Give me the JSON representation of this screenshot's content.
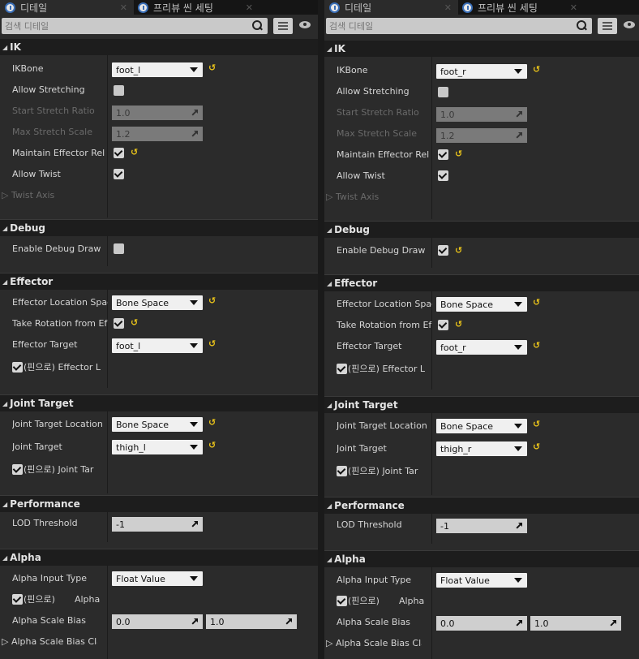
{
  "panels": [
    {
      "tabs": [
        {
          "label": "디테일"
        },
        {
          "label": "프리뷰 씬 세팅"
        }
      ],
      "search_placeholder": "검색 디테일",
      "ik": {
        "title": "IK",
        "ikbone_label": "IKBone",
        "ikbone_value": "foot_l",
        "allow_stretching": "Allow Stretching",
        "start_stretch": "Start Stretch Ratio",
        "start_stretch_value": "1.0",
        "max_stretch": "Max Stretch Scale",
        "max_stretch_value": "1.2",
        "maintain": "Maintain Effector Rel",
        "allow_twist": "Allow Twist",
        "twist_axis": "Twist Axis"
      },
      "debug": {
        "title": "Debug",
        "enable": "Enable Debug Draw",
        "enabled": false
      },
      "effector": {
        "title": "Effector",
        "loc_space": "Effector Location Spac",
        "loc_space_value": "Bone Space",
        "take_rot": "Take Rotation from Ef",
        "target": "Effector Target",
        "target_value": "foot_l",
        "pin": "(핀으로) Effector L"
      },
      "joint": {
        "title": "Joint Target",
        "loc": "Joint Target Location",
        "loc_value": "Bone Space",
        "target": "Joint Target",
        "target_value": "thigh_l",
        "pin": "(핀으로) Joint Tar"
      },
      "perf": {
        "title": "Performance",
        "lod": "LOD Threshold",
        "lod_value": "-1"
      },
      "alpha": {
        "title": "Alpha",
        "input_type": "Alpha Input Type",
        "input_type_value": "Float Value",
        "pin": "(핀으로)",
        "pin_name": "Alpha",
        "scale_bias": "Alpha Scale Bias",
        "bias_min": "0.0",
        "bias_max": "1.0",
        "clamp": "Alpha Scale Bias Clam"
      }
    },
    {
      "tabs": [
        {
          "label": "디테일"
        },
        {
          "label": "프리뷰 씬 세팅"
        }
      ],
      "search_placeholder": "검색 디테일",
      "ik": {
        "title": "IK",
        "ikbone_label": "IKBone",
        "ikbone_value": "foot_r",
        "allow_stretching": "Allow Stretching",
        "start_stretch": "Start Stretch Ratio",
        "start_stretch_value": "1.0",
        "max_stretch": "Max Stretch Scale",
        "max_stretch_value": "1.2",
        "maintain": "Maintain Effector Rel",
        "allow_twist": "Allow Twist",
        "twist_axis": "Twist Axis"
      },
      "debug": {
        "title": "Debug",
        "enable": "Enable Debug Draw",
        "enabled": true
      },
      "effector": {
        "title": "Effector",
        "loc_space": "Effector Location Spac",
        "loc_space_value": "Bone Space",
        "take_rot": "Take Rotation from Ef",
        "target": "Effector Target",
        "target_value": "foot_r",
        "pin": "(핀으로) Effector L"
      },
      "joint": {
        "title": "Joint Target",
        "loc": "Joint Target Location",
        "loc_value": "Bone Space",
        "target": "Joint Target",
        "target_value": "thigh_r",
        "pin": "(핀으로) Joint Tar"
      },
      "perf": {
        "title": "Performance",
        "lod": "LOD Threshold",
        "lod_value": "-1"
      },
      "alpha": {
        "title": "Alpha",
        "input_type": "Alpha Input Type",
        "input_type_value": "Float Value",
        "pin": "(핀으로)",
        "pin_name": "Alpha",
        "scale_bias": "Alpha Scale Bias",
        "bias_min": "0.0",
        "bias_max": "1.0",
        "clamp": "Alpha Scale Bias Clam"
      }
    }
  ],
  "colors": {
    "reset_arrow": "#e8c21a",
    "panel_bg": "#2b2b2b",
    "category_bg": "#1d1d1d"
  },
  "icons": {
    "tab": "details-icon",
    "search": "search-icon",
    "view": "view-options-icon",
    "visibility": "eye-icon",
    "reset": "reset-to-default-icon",
    "dropdown": "chevron-down-icon"
  }
}
